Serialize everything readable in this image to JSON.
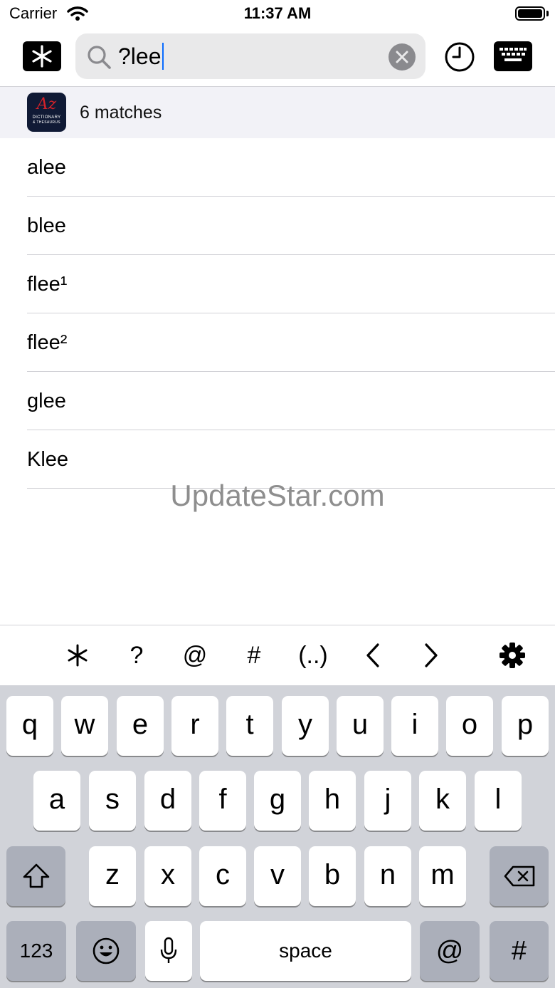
{
  "status_bar": {
    "carrier": "Carrier",
    "time": "11:37 AM"
  },
  "toolbar": {
    "wildcard_icon": "asterisk-icon",
    "history_icon": "clock-icon",
    "keyboard_icon": "keyboard-icon"
  },
  "search": {
    "value": "?lee",
    "clear_icon": "clear-icon"
  },
  "results": {
    "count_label": "6 matches",
    "app_icon": {
      "top": "Az",
      "line1": "DICTIONARY",
      "line2": "& THESAURUS"
    },
    "items": [
      "alee",
      "blee",
      "flee¹",
      "flee²",
      "glee",
      "Klee"
    ]
  },
  "watermark": "UpdateStar.com",
  "accessory": {
    "keys": [
      "*",
      "?",
      "@",
      "#",
      "(..)",
      "<",
      ">"
    ],
    "settings_icon": "gear-icon"
  },
  "keyboard": {
    "row1": [
      "q",
      "w",
      "e",
      "r",
      "t",
      "y",
      "u",
      "i",
      "o",
      "p"
    ],
    "row2": [
      "a",
      "s",
      "d",
      "f",
      "g",
      "h",
      "j",
      "k",
      "l"
    ],
    "row3": [
      "z",
      "x",
      "c",
      "v",
      "b",
      "n",
      "m"
    ],
    "numbers": "123",
    "space": "space",
    "at": "@",
    "hash": "#"
  }
}
